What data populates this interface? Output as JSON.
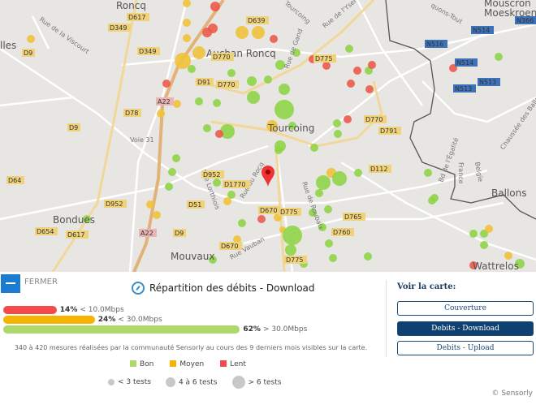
{
  "map": {
    "places": [
      "Roncq",
      "Auchan Roncq",
      "Tourcoing",
      "Bondues",
      "Mouvaux",
      "Wattrelos",
      "Ballons",
      "Mouscron",
      "Moeskroen",
      "lles"
    ],
    "streets": [
      "Rue de la Viscourt",
      "Rue de l'Yser",
      "Rue de Gand",
      "Rue Lorthiois",
      "Rue du Rocq",
      "Rue Vauban",
      "Rue de Roubaix",
      "Bd de l'Égalité",
      "France",
      "Belgïe",
      "Chaussée des Ballons",
      "Voie 31",
      "Tourcoing",
      "quons-Tout"
    ],
    "roads": [
      "D617",
      "D349",
      "D349",
      "D639",
      "D770",
      "D91",
      "D770",
      "A22",
      "D78",
      "D9",
      "D9",
      "D64",
      "D952",
      "D654",
      "D617",
      "A22",
      "D9",
      "D51",
      "D952",
      "D1770",
      "D670",
      "D670",
      "D775",
      "D775",
      "D760",
      "D765",
      "D112",
      "D770",
      "D791",
      "D775",
      "N516",
      "N514",
      "N514",
      "N513",
      "N513",
      "N366"
    ],
    "colors": {
      "bon": "#8fd448",
      "moyen": "#f0c23a",
      "lent": "#ec5a4a"
    }
  },
  "panel": {
    "close_label": "FERMER",
    "title": "Répartition des débits - Download",
    "bars": [
      {
        "percent": 14,
        "pct_label": "14%",
        "range": "< 10.0Mbps",
        "color": "#f44a4a"
      },
      {
        "percent": 24,
        "pct_label": "24%",
        "range": "< 30.0Mbps",
        "color": "#f4b400"
      },
      {
        "percent": 62,
        "pct_label": "62%",
        "range": "> 30.0Mbps",
        "color": "#acd86c"
      }
    ],
    "note": "340 à 420 mesures réalisées par la communauté Sensorly au cours des 9 derniers mois visibles sur la carte.",
    "legend": [
      {
        "label": "Bon",
        "color": "#acd86c"
      },
      {
        "label": "Moyen",
        "color": "#f4b400"
      },
      {
        "label": "Lent",
        "color": "#f44a4a"
      }
    ],
    "sizes": [
      "< 3 tests",
      "4 à 6 tests",
      "> 6 tests"
    ],
    "voir": "Voir la carte:",
    "buttons": [
      "Couverture",
      "Debits - Download",
      "Debits - Upload"
    ],
    "copyright": "© Sensorly"
  }
}
